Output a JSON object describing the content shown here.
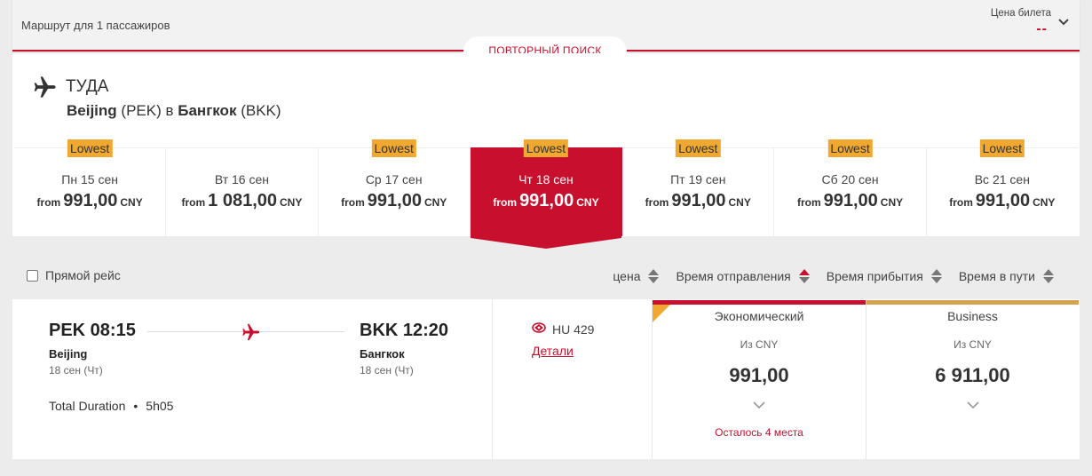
{
  "header": {
    "route_text": "Маршрут для 1 пассажиров",
    "price_label": "Цена билета",
    "price_value": "--",
    "repeat_search": "ПОВТОРНЫЙ ПОИСК"
  },
  "direction": {
    "title": "ТУДА",
    "from_city": "Beijing",
    "from_code": "(PEK)",
    "connector": "в",
    "to_city": "Бангкок",
    "to_code": "(BKK)"
  },
  "days": [
    {
      "badge": "Lowest",
      "label": "Пн 15 сен",
      "from": "from",
      "amount": "991,00",
      "currency": "CNY",
      "active": false
    },
    {
      "badge": "",
      "label": "Вт 16 сен",
      "from": "from",
      "amount": "1 081,00",
      "currency": "CNY",
      "active": false
    },
    {
      "badge": "Lowest",
      "label": "Ср 17 сен",
      "from": "from",
      "amount": "991,00",
      "currency": "CNY",
      "active": false
    },
    {
      "badge": "Lowest",
      "label": "Чт 18 сен",
      "from": "from",
      "amount": "991,00",
      "currency": "CNY",
      "active": true
    },
    {
      "badge": "Lowest",
      "label": "Пт 19 сен",
      "from": "from",
      "amount": "991,00",
      "currency": "CNY",
      "active": false
    },
    {
      "badge": "Lowest",
      "label": "Сб 20 сен",
      "from": "from",
      "amount": "991,00",
      "currency": "CNY",
      "active": false
    },
    {
      "badge": "Lowest",
      "label": "Вс 21 сен",
      "from": "from",
      "amount": "991,00",
      "currency": "CNY",
      "active": false
    }
  ],
  "filters": {
    "direct_label": "Прямой рейс",
    "direct_checked": false,
    "sort": [
      {
        "label": "цена",
        "state": "none"
      },
      {
        "label": "Время отправления",
        "state": "active"
      },
      {
        "label": "Время прибытия",
        "state": "none"
      },
      {
        "label": "Время в пути",
        "state": "none"
      }
    ]
  },
  "result": {
    "dep_time": "PEK 08:15",
    "dep_city": "Beijing",
    "dep_date": "18 сен (Чт)",
    "arr_time": "BKK 12:20",
    "arr_city": "Бангкок",
    "arr_date": "18 сен (Чт)",
    "duration_label": "Total Duration",
    "duration_sep": "•",
    "duration_value": "5h05",
    "flight_number": "HU 429",
    "details_link": "Детали",
    "economy": {
      "name": "Экономический",
      "from": "Из CNY",
      "price": "991,00",
      "seats": "Осталось 4 места",
      "color": "#c8102e"
    },
    "business": {
      "name": "Business",
      "from": "Из CNY",
      "price": "6 911,00",
      "color": "#d4a24c"
    }
  },
  "colors": {
    "brand_red": "#c8102e",
    "badge_orange": "#f0a830",
    "corner_yellow": "#f0a830"
  },
  "icons": [
    "plane-icon",
    "chevron-down-icon",
    "sort-arrows-icon",
    "airline-logo-icon"
  ]
}
